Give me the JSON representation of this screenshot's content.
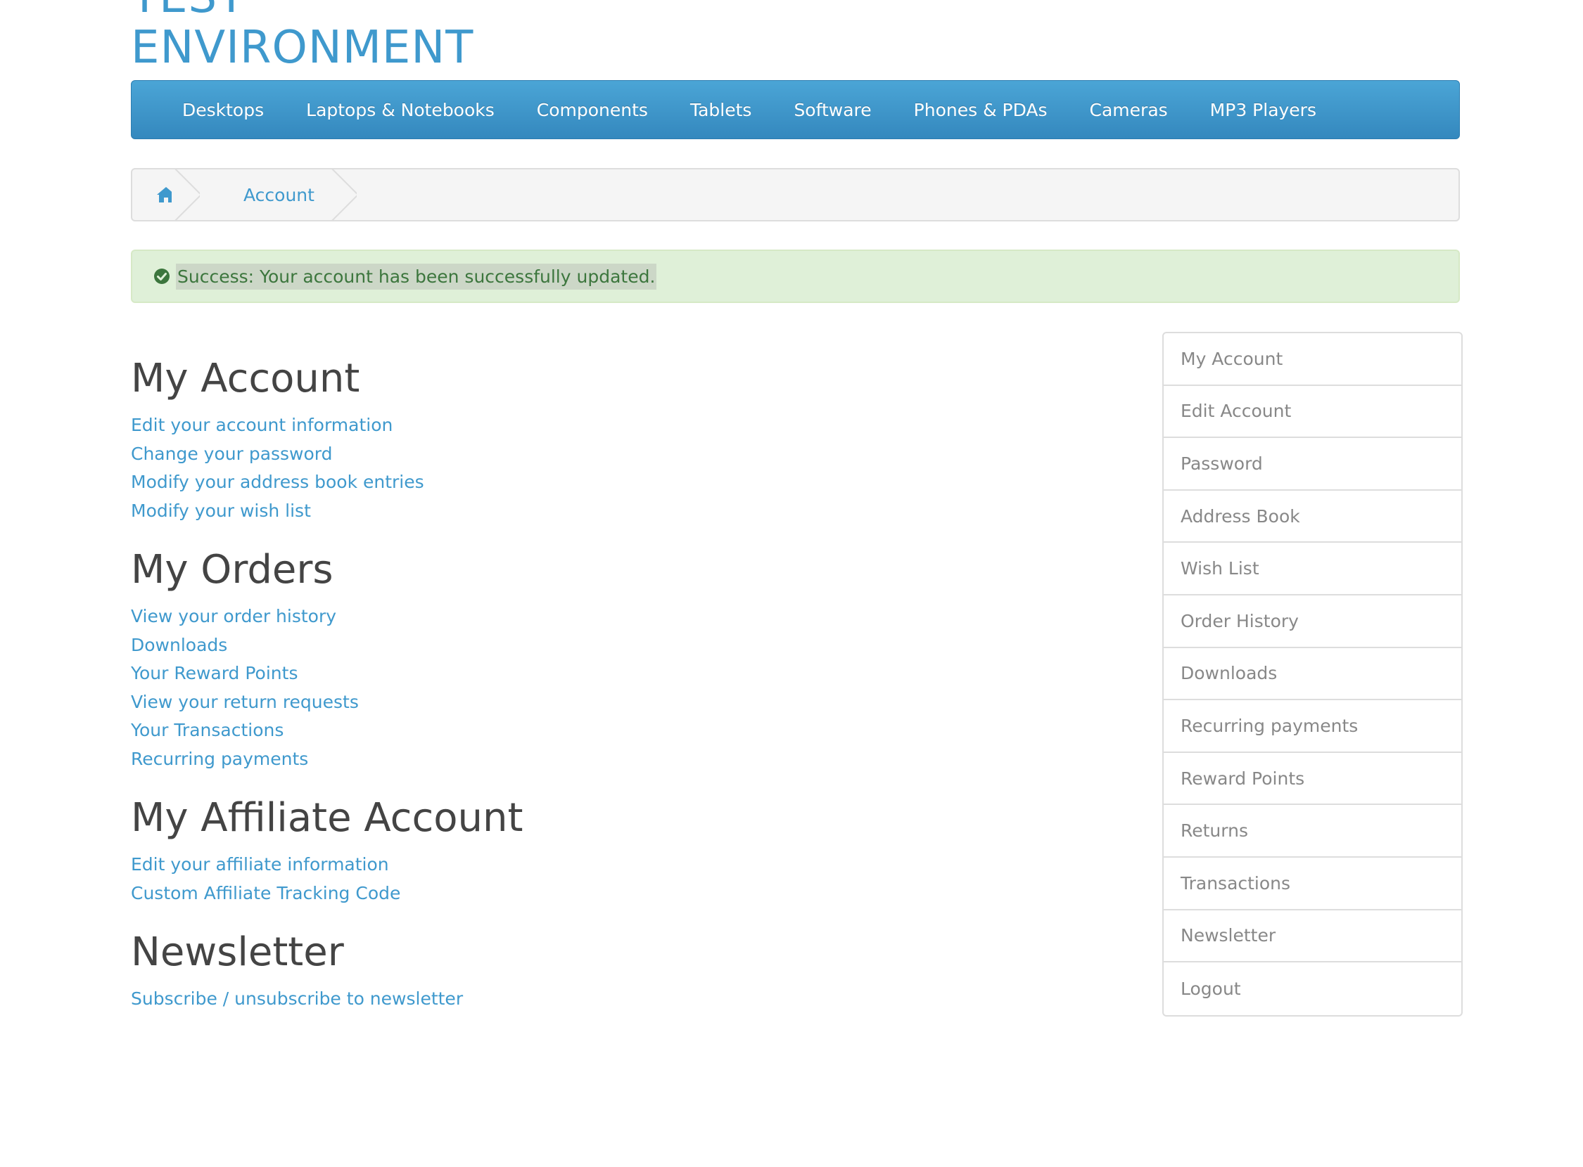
{
  "logo": {
    "line1": "TEST",
    "line2": "ENVIRONMENT"
  },
  "menu": {
    "items": [
      {
        "label": "Desktops"
      },
      {
        "label": "Laptops & Notebooks"
      },
      {
        "label": "Components"
      },
      {
        "label": "Tablets"
      },
      {
        "label": "Software"
      },
      {
        "label": "Phones & PDAs"
      },
      {
        "label": "Cameras"
      },
      {
        "label": "MP3 Players"
      }
    ]
  },
  "breadcrumb": {
    "home_icon": "home-icon",
    "account": "Account"
  },
  "alert": {
    "icon": "check-circle-icon",
    "message": "Success: Your account has been successfully updated.",
    "color": "#3c763d"
  },
  "sections": {
    "my_account": {
      "title": "My Account",
      "links": [
        "Edit your account information",
        "Change your password",
        "Modify your address book entries",
        "Modify your wish list"
      ]
    },
    "my_orders": {
      "title": "My Orders",
      "links": [
        "View your order history",
        "Downloads",
        "Your Reward Points",
        "View your return requests",
        "Your Transactions",
        "Recurring payments"
      ]
    },
    "affiliate": {
      "title": "My Affiliate Account",
      "links": [
        "Edit your affiliate information",
        "Custom Affiliate Tracking Code"
      ]
    },
    "newsletter": {
      "title": "Newsletter",
      "links": [
        "Subscribe / unsubscribe to newsletter"
      ]
    }
  },
  "sidebar": {
    "items": [
      "My Account",
      "Edit Account",
      "Password",
      "Address Book",
      "Wish List",
      "Order History",
      "Downloads",
      "Recurring payments",
      "Reward Points",
      "Returns",
      "Transactions",
      "Newsletter",
      "Logout"
    ]
  },
  "colors": {
    "accent": "#3f99cd",
    "menu_bg": "#3a93c9",
    "alert_bg": "#dff0d8"
  }
}
